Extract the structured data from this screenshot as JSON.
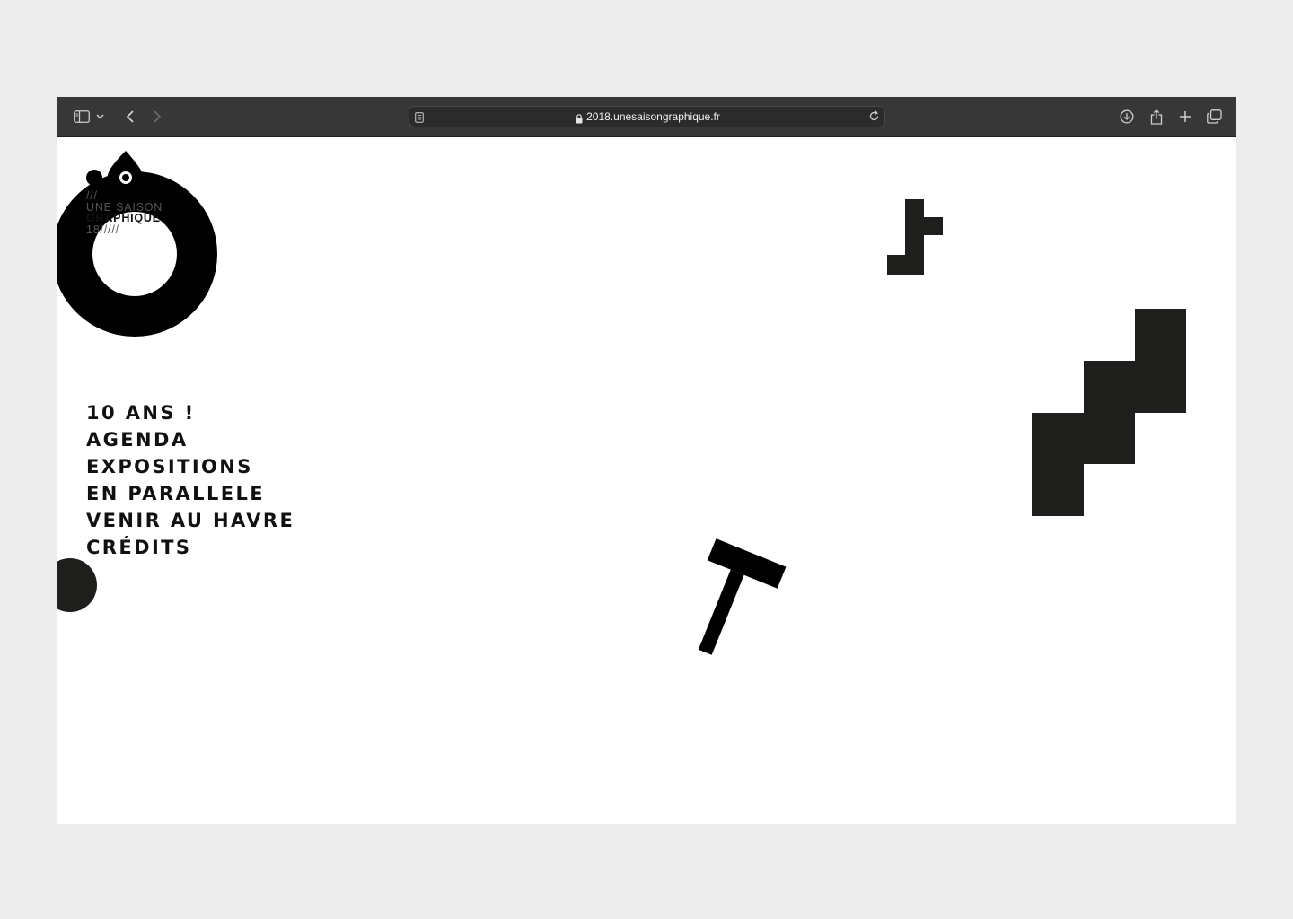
{
  "browser": {
    "url": "2018.unesaisongraphique.fr",
    "icons": [
      "sidebar-icon",
      "chevron-down-icon",
      "back-icon",
      "forward-icon",
      "reader-icon",
      "lock-icon",
      "reload-icon",
      "download-icon",
      "share-icon",
      "new-tab-icon",
      "tab-overview-icon"
    ]
  },
  "logo": {
    "line1": "///",
    "line2": "UNE SAISON",
    "line3": "GRAPHIQUE",
    "line4": "18/////"
  },
  "menu": {
    "items": [
      {
        "label": "10 ANS !"
      },
      {
        "label": "AGENDA"
      },
      {
        "label": "EXPOSITIONS"
      },
      {
        "label": "EN PARALLELE"
      },
      {
        "label": "VENIR AU HAVRE"
      },
      {
        "label": "CRÉDITS"
      }
    ]
  },
  "colors": {
    "frame": "#ededed",
    "toolbar": "#373737",
    "ink": "#000000",
    "ink_soft": "#1e1e1c"
  }
}
